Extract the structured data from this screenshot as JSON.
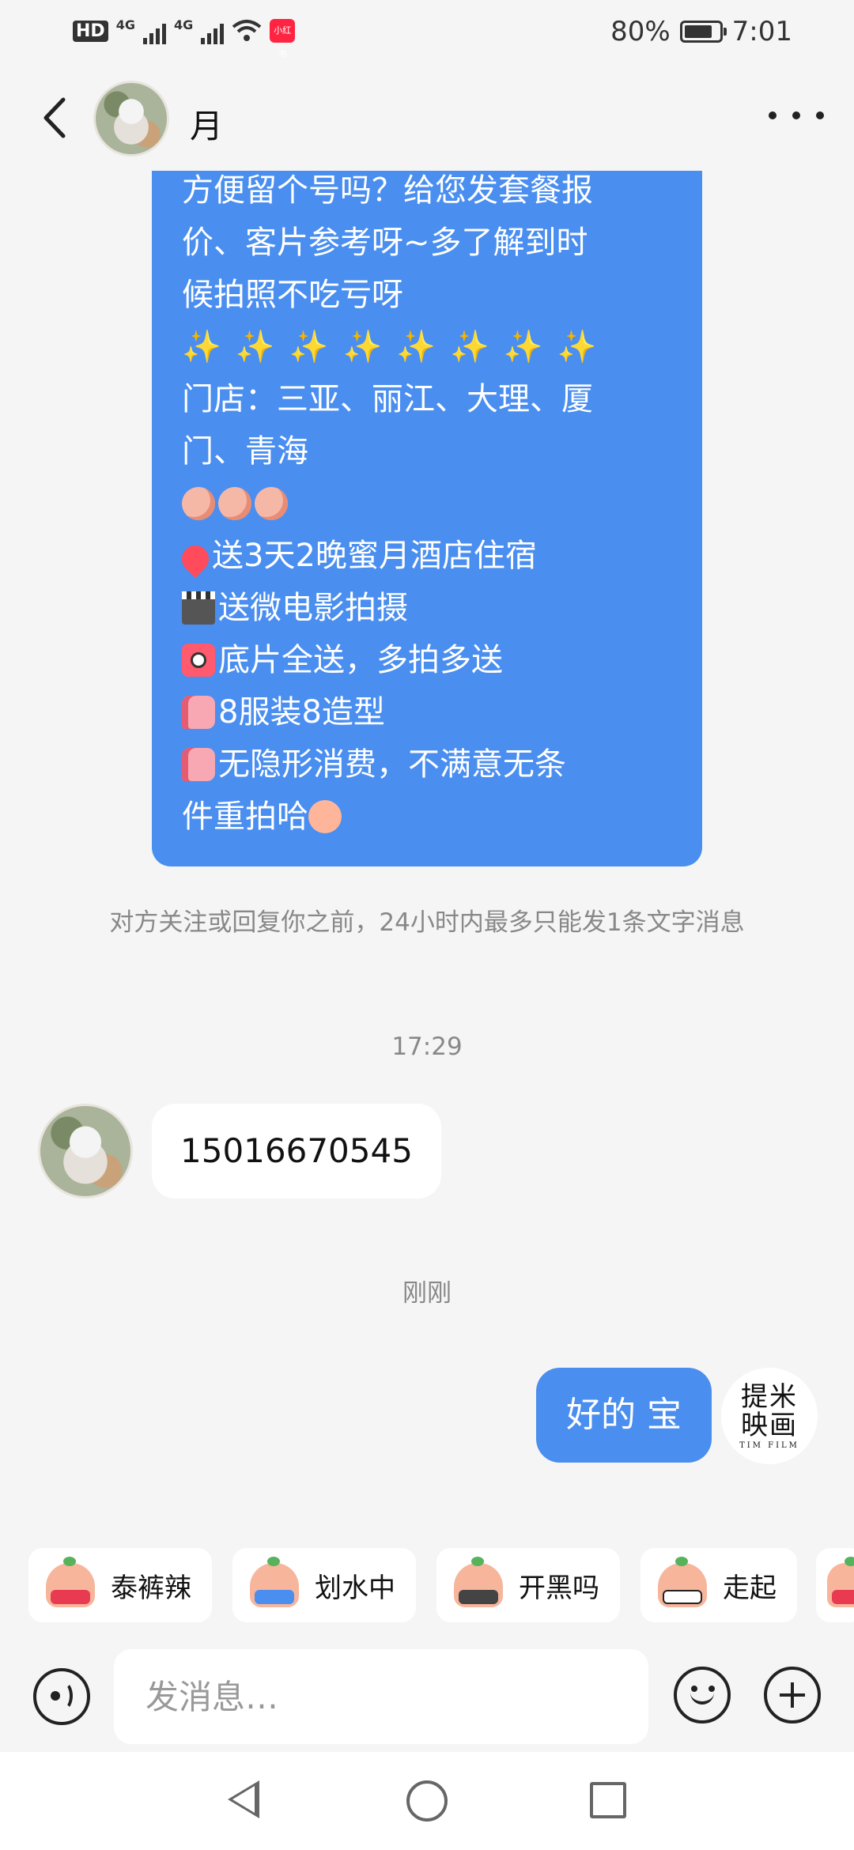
{
  "status_bar": {
    "left_badge": "HD",
    "network_1": "4G",
    "network_2": "4G",
    "app_badge": "小红书",
    "battery_percent": "80%",
    "battery_level": 0.8,
    "time": "7:01"
  },
  "header": {
    "contact_name": "月"
  },
  "messages": {
    "promo_lines": [
      "方便留个号吗？给您发套餐报",
      "价、客片参考呀~多了解到时",
      "候拍照不吃亏呀",
      "",
      "门店：三亚、丽江、大理、厦",
      "门、青海",
      "",
      "送3天2晚蜜月酒店住宿",
      "送微电影拍摄",
      "底片全送，多拍多送",
      "8服装8造型",
      "无隐形消费，不满意无条",
      "件重拍哈"
    ],
    "sparkle": "✨",
    "system_note": "对方关注或回复你之前，24小时内最多只能发1条文字消息",
    "time_1": "17:29",
    "incoming_phone": "15016670545",
    "time_2": "刚刚",
    "outgoing_reply": "好的 宝",
    "my_avatar_text": "提米映画",
    "my_avatar_sub": "TIM FILM"
  },
  "quick_replies": [
    {
      "label": "泰裤辣",
      "icon": "sticker-cool-icon"
    },
    {
      "label": "划水中",
      "icon": "sticker-swim-icon"
    },
    {
      "label": "开黑吗",
      "icon": "sticker-game-icon"
    },
    {
      "label": "走起",
      "icon": "sticker-go-icon"
    }
  ],
  "input": {
    "placeholder": "发消息…"
  }
}
